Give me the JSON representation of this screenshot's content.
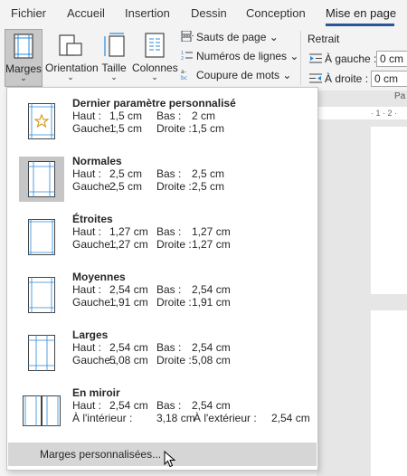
{
  "tabs": [
    "Fichier",
    "Accueil",
    "Insertion",
    "Dessin",
    "Conception",
    "Mise en page"
  ],
  "ribbon": {
    "marges": "Marges",
    "orientation": "Orientation",
    "taille": "Taille",
    "colonnes": "Colonnes",
    "sauts": "Sauts de page",
    "numeros": "Numéros de lignes",
    "coupure": "Coupure de mots",
    "chevron": "⌄",
    "small_chevron": "⌄",
    "retrait": "Retrait",
    "a_gauche": "À gauche :",
    "a_droite": "À droite :",
    "gauche_value": "0 cm",
    "droite_value": "0 cm",
    "pa": "Pa"
  },
  "ruler_text": "· 1 · 2 ·",
  "presets": [
    {
      "title": "Dernier paramètre personnalisé",
      "haut_label": "Haut :",
      "haut": "1,5 cm",
      "bas_label": "Bas :",
      "bas": "2 cm",
      "gauche_label": "Gauche :",
      "gauche": "1,5 cm",
      "droite_label": "Droite :",
      "droite": "1,5 cm"
    },
    {
      "title": "Normales",
      "haut_label": "Haut :",
      "haut": "2,5 cm",
      "bas_label": "Bas :",
      "bas": "2,5 cm",
      "gauche_label": "Gauche :",
      "gauche": "2,5 cm",
      "droite_label": "Droite :",
      "droite": "2,5 cm"
    },
    {
      "title": "Étroites",
      "haut_label": "Haut :",
      "haut": "1,27 cm",
      "bas_label": "Bas :",
      "bas": "1,27 cm",
      "gauche_label": "Gauche :",
      "gauche": "1,27 cm",
      "droite_label": "Droite :",
      "droite": "1,27 cm"
    },
    {
      "title": "Moyennes",
      "haut_label": "Haut :",
      "haut": "2,54 cm",
      "bas_label": "Bas :",
      "bas": "2,54 cm",
      "gauche_label": "Gauche :",
      "gauche": "1,91 cm",
      "droite_label": "Droite :",
      "droite": "1,91 cm"
    },
    {
      "title": "Larges",
      "haut_label": "Haut :",
      "haut": "2,54 cm",
      "bas_label": "Bas :",
      "bas": "2,54 cm",
      "gauche_label": "Gauche :",
      "gauche": "5,08 cm",
      "droite_label": "Droite :",
      "droite": "5,08 cm"
    },
    {
      "title": "En miroir",
      "haut_label": "Haut :",
      "haut": "2,54 cm",
      "bas_label": "Bas :",
      "bas": "2,54 cm",
      "gauche_label": "À l'intérieur :",
      "gauche": "3,18 cm",
      "droite_label": "À l'extérieur :",
      "droite": "2,54 cm"
    }
  ],
  "custom_margins": "Marges personnalisées..."
}
